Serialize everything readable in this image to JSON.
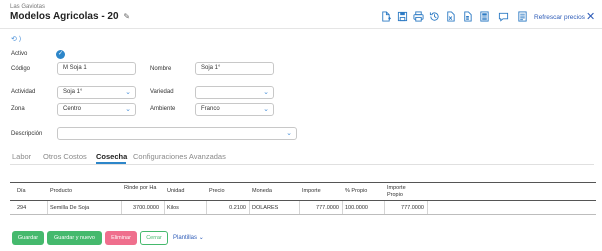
{
  "header": {
    "breadcrumb": "Las Gaviotas",
    "title": "Modelos Agricolas - 20",
    "refresh_label": "Refrescar precios"
  },
  "toolbar_icons": [
    "new-document-icon",
    "save-icon",
    "print-icon",
    "history-icon",
    "excel-icon",
    "pdf-icon",
    "form-icon",
    "comment-icon",
    "report-icon"
  ],
  "form": {
    "activo_label": "Activo",
    "codigo_label": "Código",
    "codigo_value": "M Soja 1",
    "nombre_label": "Nombre",
    "nombre_value": "Soja 1°",
    "actividad_label": "Actividad",
    "actividad_value": "Soja 1°",
    "variedad_label": "Variedad",
    "variedad_value": "",
    "zona_label": "Zona",
    "zona_value": "Centro",
    "ambiente_label": "Ambiente",
    "ambiente_value": "Franco",
    "descripcion_label": "Descripción",
    "descripcion_value": ""
  },
  "tabs": [
    "Labor",
    "Otros Costos",
    "Cosecha",
    "Configuraciones Avanzadas"
  ],
  "active_tab": "Cosecha",
  "table": {
    "headers": [
      "Día",
      "Producto",
      "Rinde por Ha",
      "Unidad",
      "Precio",
      "Moneda",
      "Importe",
      "% Propio",
      "Importe Propio"
    ],
    "rows": [
      [
        "294",
        "Semilla De Soja",
        "3700.0000",
        "Kilos",
        "0.2100",
        "DOLARES",
        "777.0000",
        "100.0000",
        "777.0000"
      ]
    ]
  },
  "buttons": {
    "guardar": "Guardar",
    "guardar_nuevo": "Guardar y nuevo",
    "eliminar": "Eliminar",
    "cerrar": "Cerrar",
    "plantillas": "Plantillas"
  },
  "colors": {
    "accent": "#2d86c9",
    "link": "#2e5cb8",
    "success": "#45b96d",
    "danger": "#ef6f8d"
  }
}
